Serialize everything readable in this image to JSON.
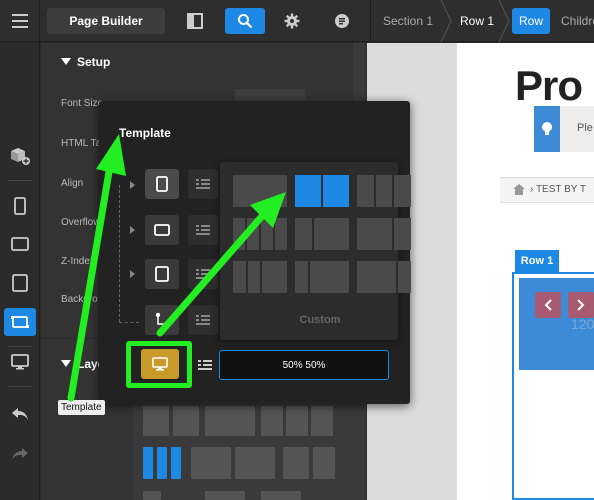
{
  "topbar": {
    "app_label": "Page Builder",
    "breadcrumbs": [
      "Section 1",
      "Row 1"
    ],
    "active_element": "Row",
    "next_crumb": "Children"
  },
  "panel": {
    "section_title": "Setup",
    "properties": [
      "Font Size",
      "HTML Ta",
      "Align",
      "Overflow",
      "Z-Index",
      "Backgro"
    ],
    "layout_title": "Layo"
  },
  "popover": {
    "title": "Template",
    "custom_label": "Custom",
    "layout_value": "50% 50%"
  },
  "tooltip": {
    "text": "Template"
  },
  "preview": {
    "title": "Pro",
    "hint_text": "Ple",
    "breadcrumb_text": "TEST BY T",
    "row_label": "Row 1",
    "faint_number": "120"
  },
  "colors": {
    "accent": "#1e88e5",
    "highlight": "#22ee22",
    "selected_template": "#c89a2a"
  },
  "icons": [
    "hamburger-icon",
    "sidebar-toggle-icon",
    "search-icon",
    "gear-icon",
    "code-icon",
    "add-components-icon",
    "phone-icon",
    "tablet-landscape-icon",
    "tablet-icon",
    "row-icon",
    "monitor-icon",
    "undo-icon",
    "redo-icon",
    "lightbulb-icon",
    "home-icon"
  ]
}
